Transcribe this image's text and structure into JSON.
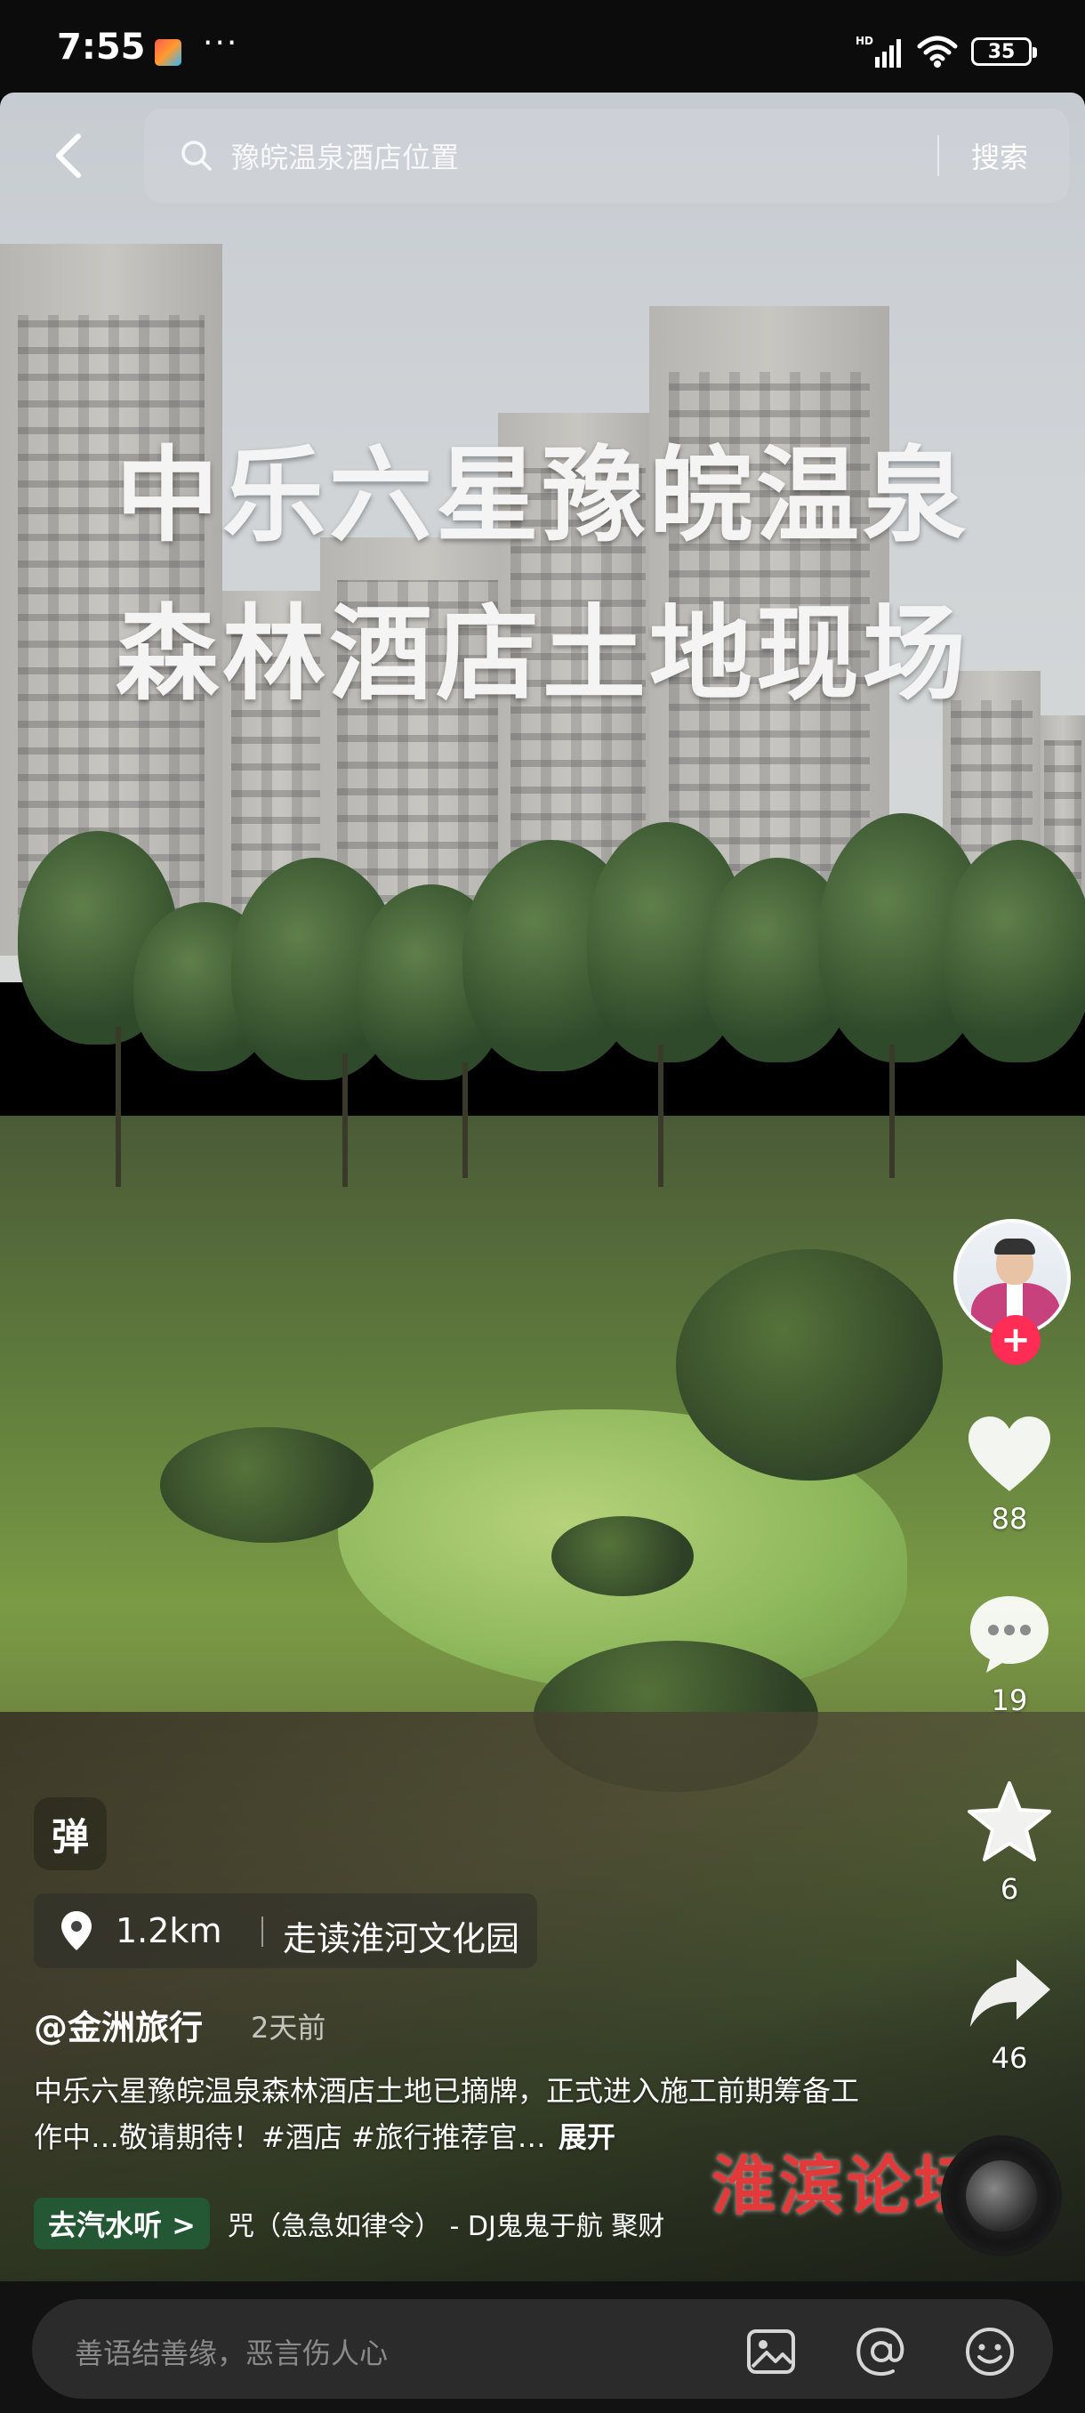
{
  "status_bar": {
    "time": "7:55",
    "more": "···",
    "network": "HD",
    "battery": "35"
  },
  "search": {
    "placeholder": "豫皖温泉酒店位置",
    "button_label": "搜索"
  },
  "video": {
    "title_line1": "中乐六星豫皖温泉",
    "title_line2": "森林酒店土地现场"
  },
  "side_actions": {
    "likes": "88",
    "comments": "19",
    "favorites": "6",
    "shares": "46"
  },
  "danmu_label": "弹",
  "location": {
    "distance": "1.2km",
    "name": "走读淮河文化园"
  },
  "post": {
    "author": "@金洲旅行",
    "time": "2天前",
    "caption": "中乐六星豫皖温泉森林酒店土地已摘牌，正式进入施工前期筹备工作中…敬请期待！#酒店 #旅行推荐官…",
    "expand": "展开"
  },
  "music": {
    "tag": "去汽水听 >",
    "text": "咒（急急如律令） - DJ鬼鬼于航    聚财"
  },
  "watermark": "淮滨论坛",
  "comment_bar": {
    "placeholder": "善语结善缘，恶言伤人心"
  },
  "icons": {
    "back": "back-arrow-icon",
    "search": "search-icon",
    "heart": "heart-icon",
    "comment": "comment-icon",
    "star": "star-icon",
    "share": "share-icon",
    "pin": "location-pin-icon",
    "image": "image-icon",
    "at": "at-icon",
    "emoji": "emoji-icon"
  },
  "colors": {
    "follow": "#ff2c55",
    "music_tag": "#245c36",
    "watermark": "#e23a3a"
  }
}
